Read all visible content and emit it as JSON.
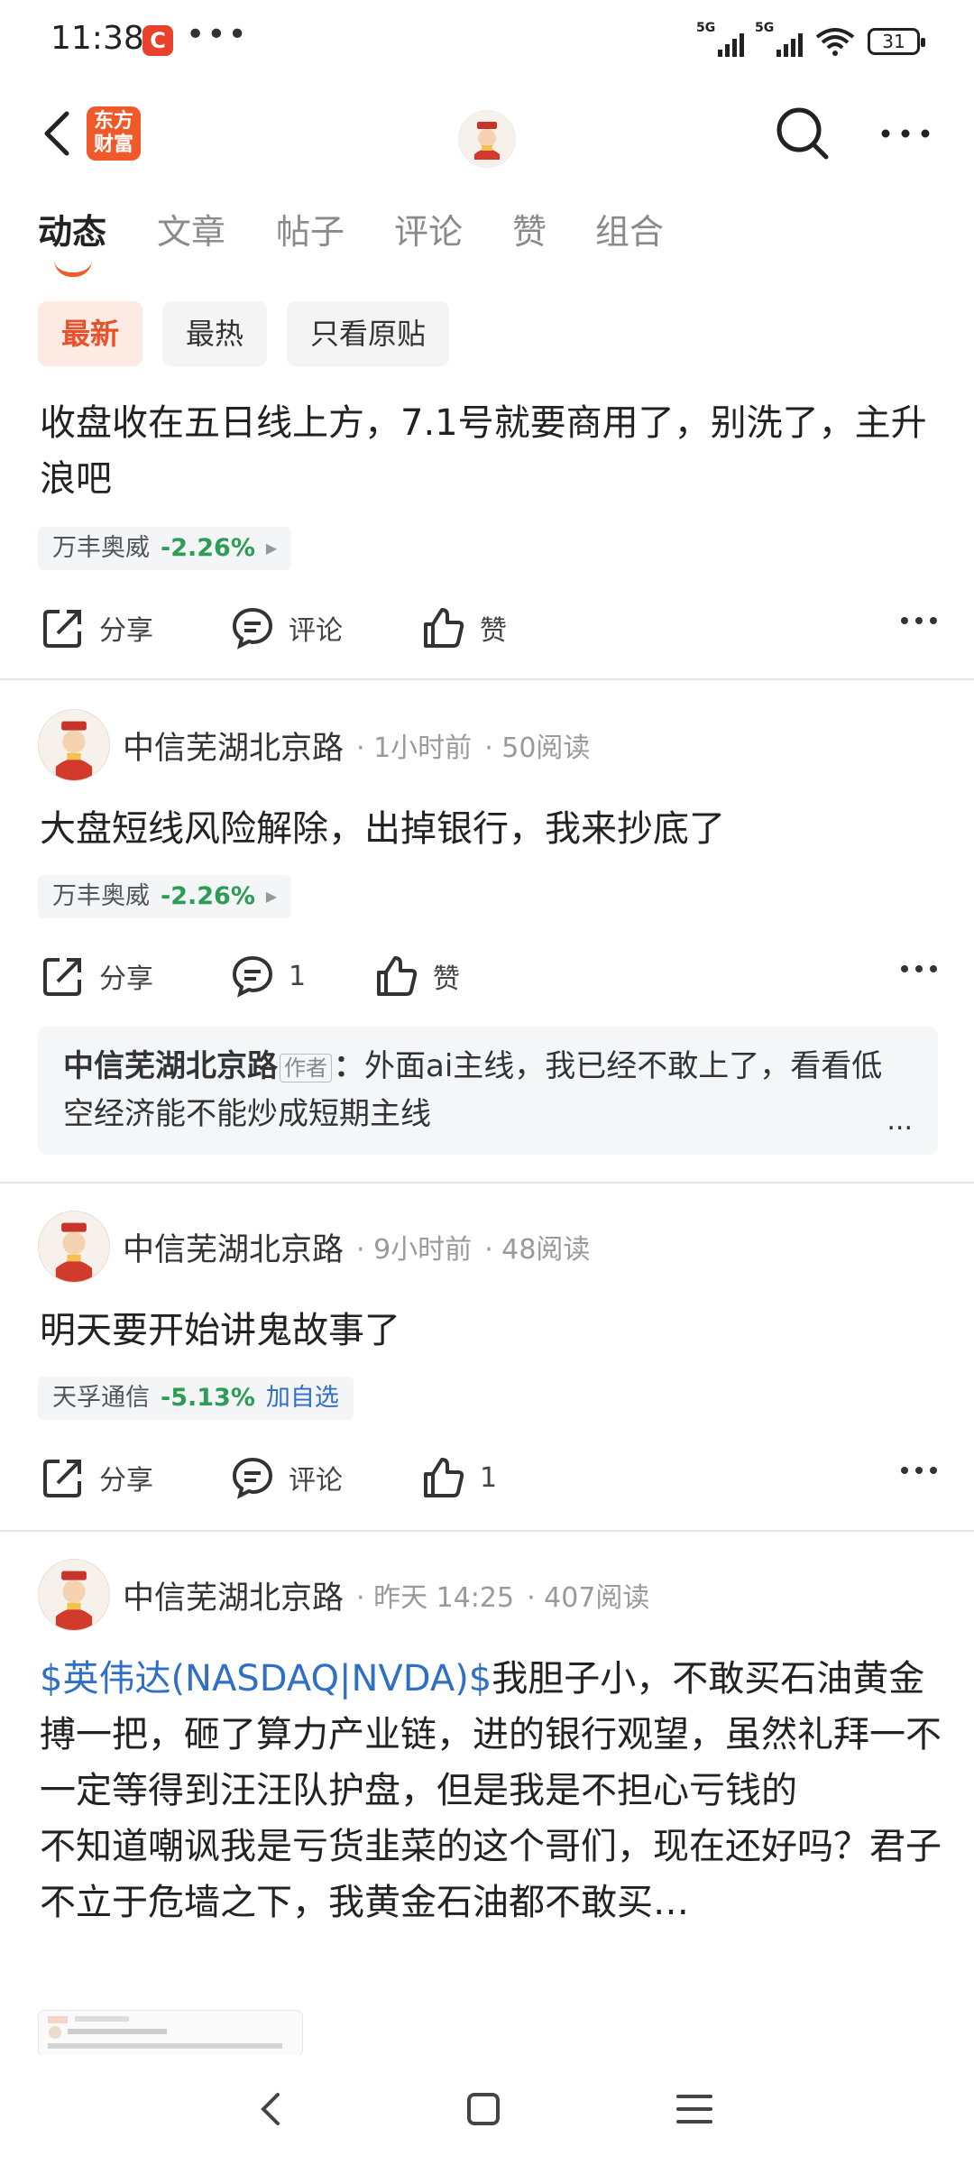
{
  "status_bar": {
    "time": "11:38",
    "app_badge": "C",
    "more_dots": "•••",
    "network_1": "5G",
    "network_2": "5G",
    "battery": "31"
  },
  "header": {
    "logo_line1": "东方",
    "logo_line2": "财富"
  },
  "tabs": [
    {
      "label": "动态",
      "active": true
    },
    {
      "label": "文章"
    },
    {
      "label": "帖子"
    },
    {
      "label": "评论"
    },
    {
      "label": "赞"
    },
    {
      "label": "组合"
    }
  ],
  "filters": [
    {
      "label": "最新",
      "active": true
    },
    {
      "label": "最热"
    },
    {
      "label": "只看原贴"
    }
  ],
  "posts": [
    {
      "text": "收盘收在五日线上方，7.1号就要商用了，别洗了，主升浪吧",
      "stock": {
        "name": "万丰奥威",
        "change": "-2.26%",
        "color": "#2d9c55"
      },
      "actions": {
        "share": "分享",
        "comment": "评论",
        "like": "赞"
      }
    },
    {
      "author": "中信芜湖北京路",
      "time": "· 1小时前",
      "reads": "· 50阅读",
      "text": "大盘短线风险解除，出掉银行，我来抄底了",
      "stock": {
        "name": "万丰奥威",
        "change": "-2.26%"
      },
      "actions": {
        "share": "分享",
        "comment": "1",
        "like": "赞"
      },
      "reply": {
        "author": "中信芜湖北京路",
        "badge": "作者",
        "colon": "：",
        "text": "外面ai主线，我已经不敢上了，看看低空经济能不能炒成短期主线",
        "ellipsis": "..."
      }
    },
    {
      "author": "中信芜湖北京路",
      "time": "· 9小时前",
      "reads": "· 48阅读",
      "text": "明天要开始讲鬼故事了",
      "stock": {
        "name": "天孚通信",
        "change": "-5.13%",
        "add": "加自选"
      },
      "actions": {
        "share": "分享",
        "comment": "评论",
        "like": "1"
      }
    },
    {
      "author": "中信芜湖北京路",
      "time": "· 昨天 14:25",
      "reads": "· 407阅读",
      "link": "$英伟达(NASDAQ|NVDA)$",
      "text": "我胆子小，不敢买石油黄金搏一把，砸了算力产业链，进的银行观望，虽然礼拜一不一定等得到汪汪队护盘，但是我是不担心亏钱的",
      "text2": "不知道嘲讽我是亏货韭菜的这个哥们，现在还好吗？君子不立于危墙之下，我黄金石油都不敢买…"
    }
  ],
  "nav": {
    "back": "‹",
    "home": "□",
    "menu": "≡"
  }
}
